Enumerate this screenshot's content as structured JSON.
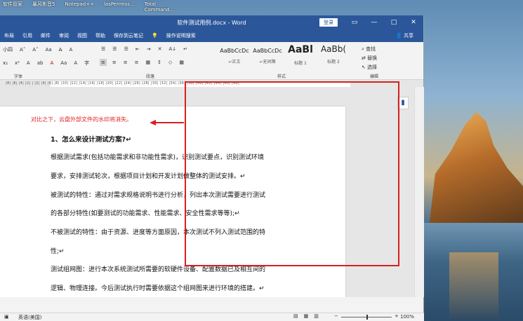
{
  "desktop": {
    "labels": [
      "软件管家",
      "暴风影音5",
      "Notepad++",
      "lasPermiss...",
      "Total Command..."
    ]
  },
  "window": {
    "title": "软件测试用例.docx - Word",
    "signin_label": "登录",
    "controls": [
      "▭",
      "—",
      "□",
      "✕"
    ]
  },
  "ribbon_tabs": [
    "布局",
    "引用",
    "邮件",
    "审阅",
    "视图",
    "帮助",
    "保存到云笔记",
    "操作说明搜索"
  ],
  "share_label": "共享",
  "ribbon": {
    "font_row1": [
      "小四",
      "A˄",
      "A˅",
      "Aa",
      "A̶",
      "A"
    ],
    "font_row2": [
      "x₂",
      "x²",
      "A",
      "ab",
      "A",
      "Aa",
      "A",
      "字"
    ],
    "para_row1": [
      "☰",
      "☰",
      "☰",
      "⇤",
      "⇥",
      "✕",
      "A↓",
      "↵"
    ],
    "para_row2": [
      "≡",
      "≡",
      "≡",
      "≡",
      "▦",
      "↕",
      "◇",
      "▦"
    ],
    "styles": [
      {
        "sample": "AaBbCcDc",
        "name": "↵正文"
      },
      {
        "sample": "AaBbCcDc",
        "name": "↵无间隔"
      },
      {
        "sample": "AaBl",
        "name": "标题 1"
      },
      {
        "sample": "AaBb(",
        "name": "标题 2"
      }
    ],
    "editing": {
      "find": "查找",
      "replace": "替换",
      "select": "选择"
    },
    "group_labels": {
      "font": "字体",
      "paragraph": "段落",
      "styles": "样式",
      "editing": "编辑"
    }
  },
  "ruler_numbers": "|8| |6| |4| |2| |  |2| |4| |6| |8| |10| |12| |14| |16| |18| |20| |22| |24| |26| |28| |30| |32| |34| |36| |38| |40| |42| |44| |46| |48|",
  "document": {
    "paragraphs": [
      {
        "text": "1、怎么来设计测试方案?↵",
        "heading": true
      },
      {
        "text": "根据测试需求(包括功能需求和非功能性需求)，识别测试要点，识别测试环境",
        "heading": false
      },
      {
        "text": "要求，安排测试轮次，根据项目计划和开发计划做整体的测试安排。↵",
        "heading": false
      },
      {
        "text": "被测试的特性：通过对需求规格说明书进行分析，列出本次测试需要进行测试",
        "heading": false
      },
      {
        "text": "的各部分特性(如要测试的功能需求、性能需求、安全性需求等等);↵",
        "heading": false
      },
      {
        "text": "不被测试的特性：由于资源、进度等方面原因，本次测试不列入测试范围的特",
        "heading": false
      },
      {
        "text": "性;↵",
        "heading": false
      },
      {
        "text": "测试组网图：进行本次系统测试所需要的软硬件设备、配置数据已及相互间的",
        "heading": false
      },
      {
        "text": "逻辑、物理连接。今后测试执行时需要依据这个组网图来进行环境的搭建。↵",
        "heading": false
      }
    ]
  },
  "annotation": {
    "text": "对比之下，云盘外部文件的水印将消失。",
    "color": "#e02020"
  },
  "status": {
    "language": "英语(美国)",
    "zoom": "100%"
  },
  "colors": {
    "word_blue": "#2b579a",
    "annotation_red": "#d62020"
  }
}
